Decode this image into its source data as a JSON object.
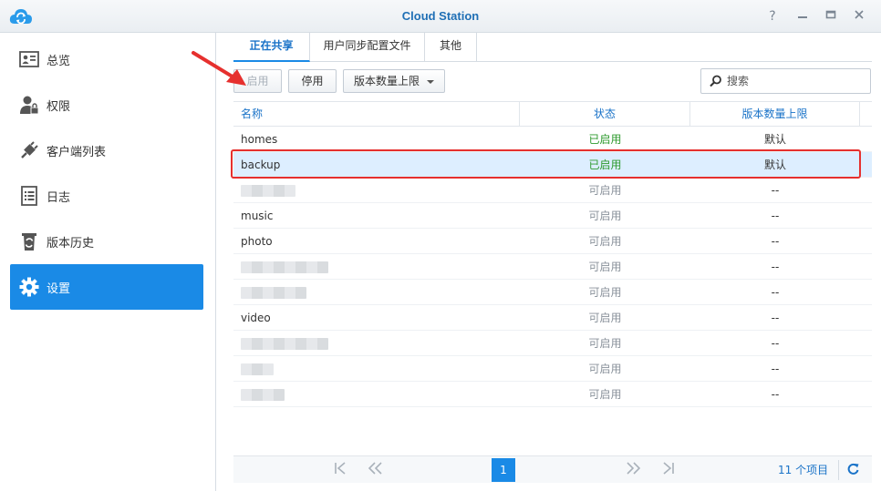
{
  "window": {
    "title": "Cloud Station"
  },
  "sidebar": {
    "items": [
      {
        "label": "总览",
        "icon": "overview-icon",
        "active": false
      },
      {
        "label": "权限",
        "icon": "user-permission-icon",
        "active": false
      },
      {
        "label": "客户端列表",
        "icon": "plug-icon",
        "active": false
      },
      {
        "label": "日志",
        "icon": "log-icon",
        "active": false
      },
      {
        "label": "版本历史",
        "icon": "version-history-icon",
        "active": false
      },
      {
        "label": "设置",
        "icon": "gear-icon",
        "active": true
      }
    ]
  },
  "tabs": [
    {
      "label": "正在共享",
      "active": true
    },
    {
      "label": "用户同步配置文件",
      "active": false
    },
    {
      "label": "其他",
      "active": false
    }
  ],
  "toolbar": {
    "enable_label": "启用",
    "disable_label": "停用",
    "version_limit_label": "版本数量上限"
  },
  "search": {
    "placeholder": "搜索"
  },
  "table": {
    "columns": [
      "名称",
      "状态",
      "版本数量上限"
    ],
    "rows": [
      {
        "name": "homes",
        "status": "已启用",
        "versions": "默认"
      },
      {
        "name": "backup",
        "status": "已启用",
        "versions": "默认"
      },
      {
        "name": "",
        "status": "可启用",
        "versions": "--"
      },
      {
        "name": "music",
        "status": "可启用",
        "versions": "--"
      },
      {
        "name": "photo",
        "status": "可启用",
        "versions": "--"
      },
      {
        "name": "",
        "status": "可启用",
        "versions": "--"
      },
      {
        "name": "",
        "status": "可启用",
        "versions": "--"
      },
      {
        "name": "video",
        "status": "可启用",
        "versions": "--"
      },
      {
        "name": "",
        "status": "可启用",
        "versions": "--"
      },
      {
        "name": "",
        "status": "可启用",
        "versions": "--"
      },
      {
        "name": "",
        "status": "可启用",
        "versions": "--"
      }
    ]
  },
  "pager": {
    "current_page": "1",
    "count_label": "11 个项目"
  },
  "colors": {
    "accent": "#1a8ae6",
    "enabled_status": "#2e9a2e",
    "highlight": "#e6302e"
  }
}
